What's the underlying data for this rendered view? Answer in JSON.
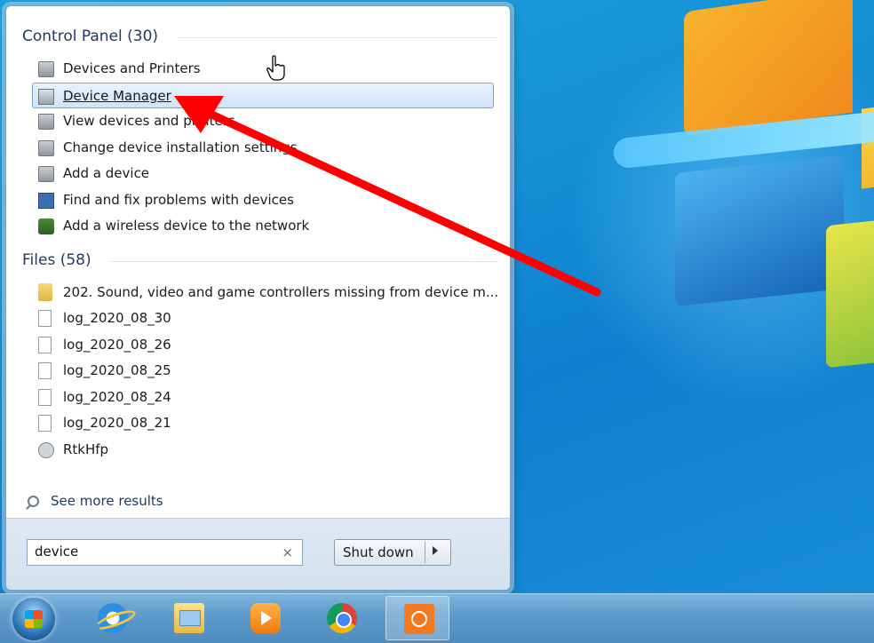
{
  "start_menu": {
    "groups": [
      {
        "title": "Control Panel (30)",
        "items": [
          {
            "label": "Devices and Printers",
            "icon": "printer-icon"
          },
          {
            "label": "Device Manager",
            "icon": "device-manager-icon",
            "selected": true
          },
          {
            "label": "View devices and printers",
            "icon": "printer-icon"
          },
          {
            "label": "Change device installation settings",
            "icon": "printer-icon"
          },
          {
            "label": "Add a device",
            "icon": "printer-icon"
          },
          {
            "label": "Find and fix problems with devices",
            "icon": "troubleshoot-icon"
          },
          {
            "label": "Add a wireless device to the network",
            "icon": "wireless-network-icon"
          }
        ]
      },
      {
        "title": "Files (58)",
        "items": [
          {
            "label": "202. Sound, video and game controllers missing from device m...",
            "icon": "folder-icon"
          },
          {
            "label": "log_2020_08_30",
            "icon": "text-file-icon"
          },
          {
            "label": "log_2020_08_26",
            "icon": "text-file-icon"
          },
          {
            "label": "log_2020_08_25",
            "icon": "text-file-icon"
          },
          {
            "label": "log_2020_08_24",
            "icon": "text-file-icon"
          },
          {
            "label": "log_2020_08_21",
            "icon": "text-file-icon"
          },
          {
            "label": "RtkHfp",
            "icon": "gear-file-icon"
          }
        ]
      }
    ],
    "see_more_label": "See more results",
    "search": {
      "value": "device",
      "clear_glyph": "×"
    },
    "shutdown_label": "Shut down"
  },
  "taskbar": {
    "items": [
      {
        "name": "start-orb",
        "icon": "windows-logo-icon"
      },
      {
        "name": "internet-explorer",
        "icon": "internet-explorer-icon"
      },
      {
        "name": "windows-explorer",
        "icon": "folder-library-icon"
      },
      {
        "name": "media-player",
        "icon": "media-player-icon"
      },
      {
        "name": "chrome",
        "icon": "chrome-icon"
      },
      {
        "name": "screen-capture",
        "icon": "screen-capture-icon",
        "active": true
      }
    ]
  },
  "annotation": {
    "arrow_color": "#ff0000"
  }
}
